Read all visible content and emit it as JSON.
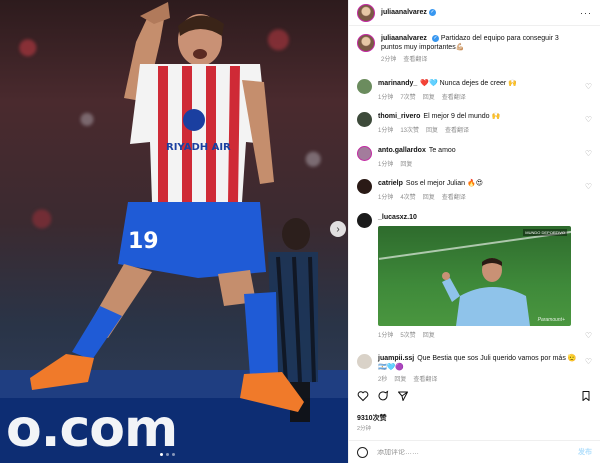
{
  "post": {
    "author": "juliaanalvarez",
    "caption": "Partidazo del equipo para conseguir 3 puntos muy importantes💪🏼",
    "caption_time": "2分钟",
    "translate_label": "查看翻译",
    "more_icon": "more-horizontal-icon"
  },
  "photo": {
    "ad_text": "o.com",
    "jersey_number": "19",
    "sponsor_text": "RIYADH AIR"
  },
  "comments": [
    {
      "user": "marinandy_",
      "text": "❤️🩵 Nunca dejes de creer 🙌",
      "time": "1分钟",
      "likes": "7次赞",
      "reply": "回复",
      "translate": "查看翻译"
    },
    {
      "user": "thomi_rivero",
      "text": "El mejor 9 del mundo 🙌",
      "time": "1分钟",
      "likes": "13次赞",
      "reply": "回复",
      "translate": "查看翻译"
    },
    {
      "user": "anto.gallardox",
      "text": "Te amoo",
      "time": "1分钟",
      "likes": "",
      "reply": "回复",
      "translate": ""
    },
    {
      "user": "catrielp",
      "text": "Sos el mejor Julian 🔥😍",
      "time": "1分钟",
      "likes": "4次赞",
      "reply": "回复",
      "translate": "查看翻译"
    },
    {
      "user": "_lucasxz.10",
      "text": "",
      "time": "1分钟",
      "likes": "5次赞",
      "reply": "回复",
      "translate": "",
      "clip_badge": "MUNDO DEPORTIVO",
      "clip_watermark": "Paramount+"
    },
    {
      "user": "juampii.ssj",
      "text": "Que Bestia que sos Juli querido vamos por más 🫡",
      "text2": "🇦🇷🩵🟣",
      "time": "2秒",
      "likes": "",
      "reply": "回复",
      "translate": "查看翻译"
    }
  ],
  "footer": {
    "likes": "9310次赞",
    "time": "2分钟",
    "comment_placeholder": "添加评论……",
    "post_label": "发布"
  }
}
